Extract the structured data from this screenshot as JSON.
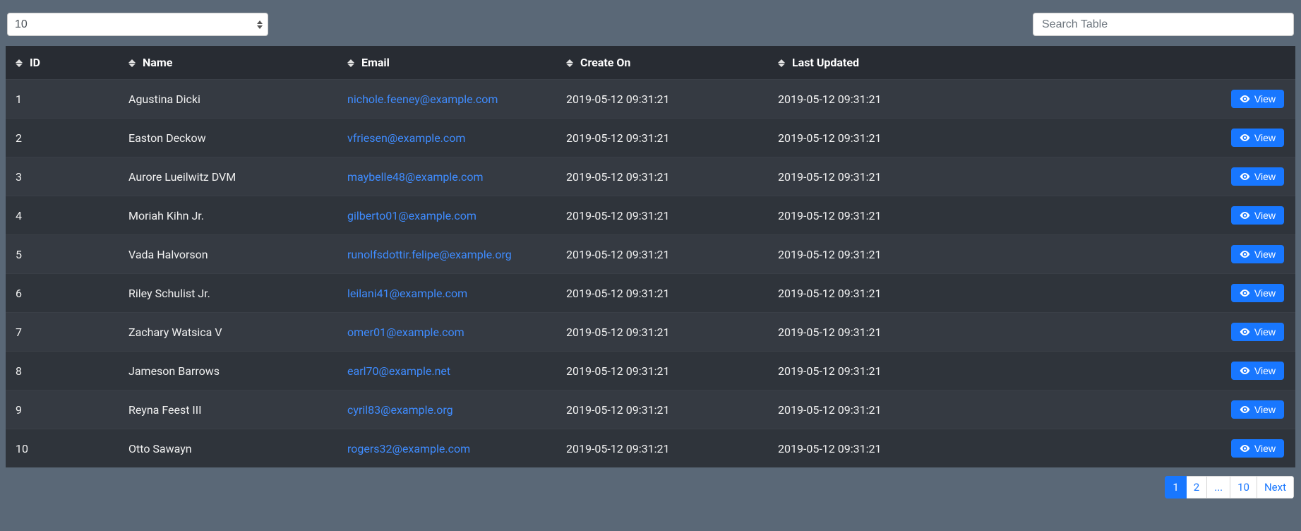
{
  "controls": {
    "page_size_value": "10",
    "search_placeholder": "Search Table"
  },
  "columns": {
    "id": "ID",
    "name": "Name",
    "email": "Email",
    "created": "Create On",
    "updated": "Last Updated"
  },
  "view_label": "View",
  "rows": [
    {
      "id": "1",
      "name": "Agustina Dicki",
      "email": "nichole.feeney@example.com",
      "created": "2019-05-12 09:31:21",
      "updated": "2019-05-12 09:31:21"
    },
    {
      "id": "2",
      "name": "Easton Deckow",
      "email": "vfriesen@example.com",
      "created": "2019-05-12 09:31:21",
      "updated": "2019-05-12 09:31:21"
    },
    {
      "id": "3",
      "name": "Aurore Lueilwitz DVM",
      "email": "maybelle48@example.com",
      "created": "2019-05-12 09:31:21",
      "updated": "2019-05-12 09:31:21"
    },
    {
      "id": "4",
      "name": "Moriah Kihn Jr.",
      "email": "gilberto01@example.com",
      "created": "2019-05-12 09:31:21",
      "updated": "2019-05-12 09:31:21"
    },
    {
      "id": "5",
      "name": "Vada Halvorson",
      "email": "runolfsdottir.felipe@example.org",
      "created": "2019-05-12 09:31:21",
      "updated": "2019-05-12 09:31:21"
    },
    {
      "id": "6",
      "name": "Riley Schulist Jr.",
      "email": "leilani41@example.com",
      "created": "2019-05-12 09:31:21",
      "updated": "2019-05-12 09:31:21"
    },
    {
      "id": "7",
      "name": "Zachary Watsica V",
      "email": "omer01@example.com",
      "created": "2019-05-12 09:31:21",
      "updated": "2019-05-12 09:31:21"
    },
    {
      "id": "8",
      "name": "Jameson Barrows",
      "email": "earl70@example.net",
      "created": "2019-05-12 09:31:21",
      "updated": "2019-05-12 09:31:21"
    },
    {
      "id": "9",
      "name": "Reyna Feest III",
      "email": "cyril83@example.org",
      "created": "2019-05-12 09:31:21",
      "updated": "2019-05-12 09:31:21"
    },
    {
      "id": "10",
      "name": "Otto Sawayn",
      "email": "rogers32@example.com",
      "created": "2019-05-12 09:31:21",
      "updated": "2019-05-12 09:31:21"
    }
  ],
  "pagination": {
    "pages": [
      "1",
      "2",
      "...",
      "10",
      "Next"
    ],
    "active": "1"
  }
}
